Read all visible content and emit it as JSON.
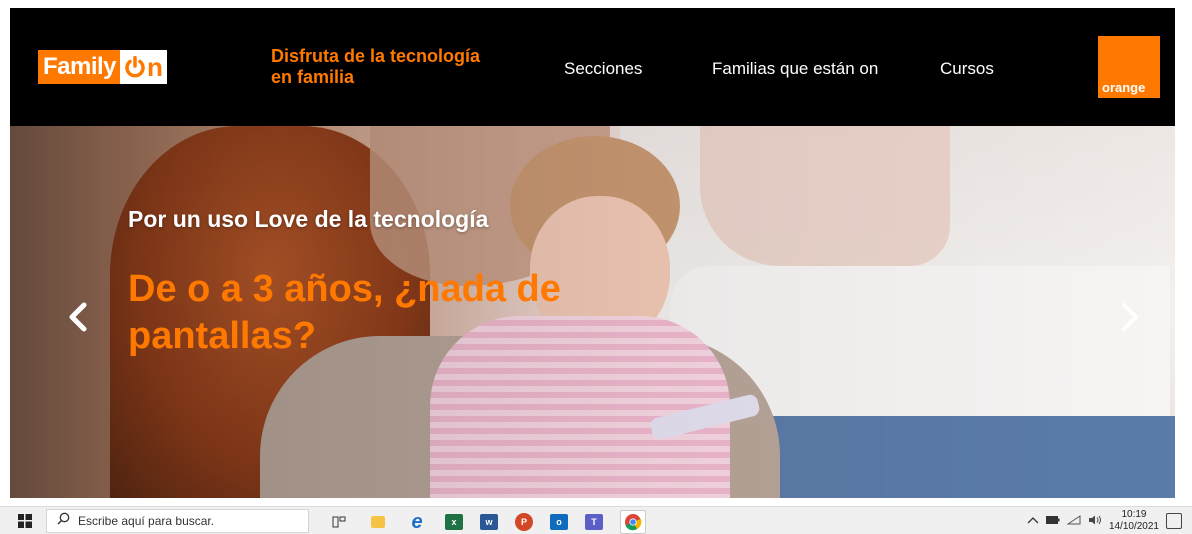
{
  "header": {
    "logo": {
      "family": "Family",
      "on": "On"
    },
    "tagline": "Disfruta de la tecnología en familia",
    "nav": [
      "Secciones",
      "Familias que están on",
      "Cursos"
    ],
    "brand": "orange"
  },
  "hero": {
    "subtitle": "Por un uso Love de la tecnología",
    "title": "De o a 3 años, ¿nada de pantallas?",
    "prev_icon": "chevron-left-icon",
    "next_icon": "chevron-right-icon"
  },
  "taskbar": {
    "search_placeholder": "Escribe aquí para buscar.",
    "apps": [
      "task-view-icon",
      "file-explorer-icon",
      "edge-icon",
      "excel-icon",
      "word-icon",
      "powerpoint-icon",
      "outlook-icon",
      "teams-icon",
      "chrome-icon"
    ],
    "time": "10:19",
    "date": "14/10/2021"
  },
  "colors": {
    "accent": "#ff7900",
    "header_bg": "#000000"
  }
}
